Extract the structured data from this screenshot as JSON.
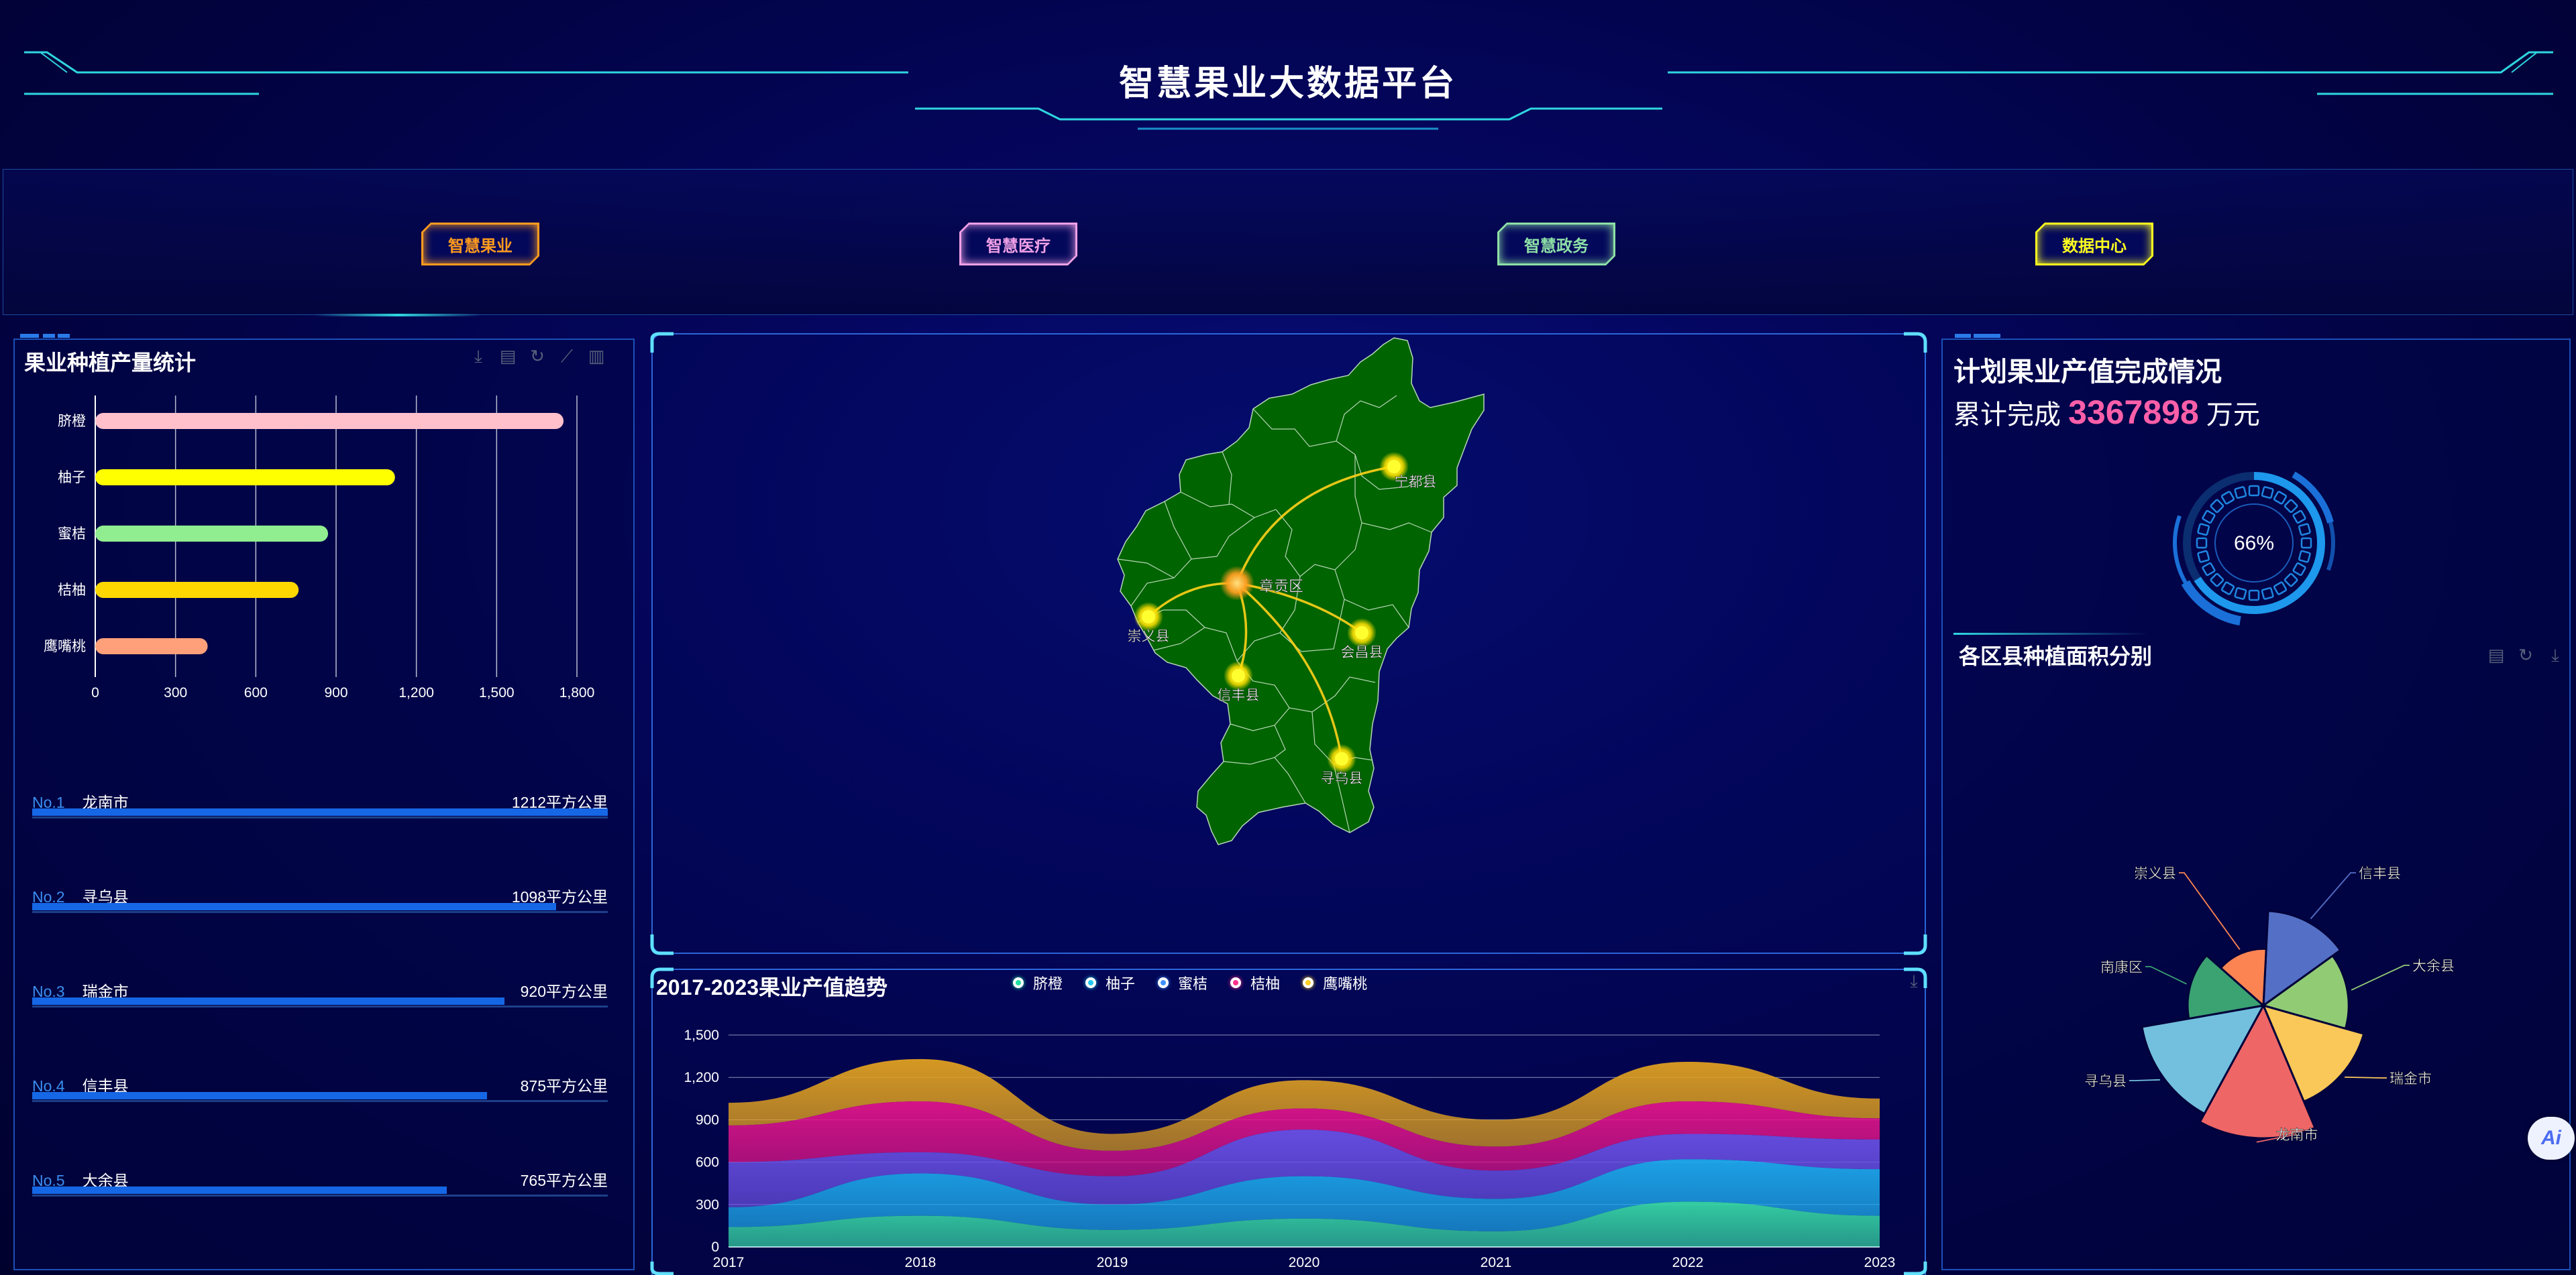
{
  "header": {
    "title": "智慧果业大数据平台"
  },
  "nav": [
    {
      "label": "智慧果业",
      "color": "#ff9b1e"
    },
    {
      "label": "智慧医疗",
      "color": "#f0a0e6"
    },
    {
      "label": "智慧政务",
      "color": "#8de0a6"
    },
    {
      "label": "数据中心",
      "color": "#ffff20"
    }
  ],
  "left": {
    "bar_title": "果业种植产量统计",
    "tools": [
      "download-icon",
      "data-view-icon",
      "refresh-icon",
      "line-chart-icon",
      "bar-chart-icon"
    ],
    "ranking": [
      {
        "no": "No.1",
        "name": "龙南市",
        "value": "1212平方公里",
        "fraction": 1.0
      },
      {
        "no": "No.2",
        "name": "寻乌县",
        "value": "1098平方公里",
        "fraction": 0.91
      },
      {
        "no": "No.3",
        "name": "瑞金市",
        "value": "920平方公里",
        "fraction": 0.82
      },
      {
        "no": "No.4",
        "name": "信丰县",
        "value": "875平方公里",
        "fraction": 0.79
      },
      {
        "no": "No.5",
        "name": "大余县",
        "value": "765平方公里",
        "fraction": 0.72
      }
    ]
  },
  "map": {
    "center": "章贡区",
    "cities": [
      "宁都县",
      "崇义县",
      "会昌县",
      "信丰县",
      "寻乌县"
    ],
    "fill": "#006400"
  },
  "trend": {
    "title": "2017-2023果业产值趋势",
    "tool": "download-icon"
  },
  "right": {
    "title": "计划果业产值完成情况",
    "total_prefix": "累计完成",
    "total_value": "3367898",
    "total_unit": "万元",
    "progress_label": "66%",
    "progress": 0.66,
    "area_title": "各区县种植面积分别",
    "tools": [
      "data-view-icon",
      "refresh-icon",
      "download-icon"
    ]
  },
  "ai_badge": "Ai",
  "chart_data": [
    {
      "type": "bar",
      "orientation": "horizontal",
      "categories": [
        "脐橙",
        "柚子",
        "蜜桔",
        "桔柚",
        "鹰嘴桃"
      ],
      "values": [
        1750,
        1120,
        870,
        760,
        420
      ],
      "colors": [
        "#ffc0cb",
        "#ffff00",
        "#90ee90",
        "#ffd700",
        "#ffa07a"
      ],
      "xticks": [
        "0",
        "300",
        "600",
        "900",
        "1,200",
        "1,500",
        "1,800"
      ],
      "xlim": [
        0,
        1800
      ],
      "grid": true
    },
    {
      "type": "area",
      "stacked": true,
      "title": "2017-2023果业产值趋势",
      "x": [
        "2017",
        "2018",
        "2019",
        "2020",
        "2021",
        "2022",
        "2023"
      ],
      "yticks": [
        "0",
        "300",
        "600",
        "900",
        "1,200",
        "1,500"
      ],
      "ylim": [
        0,
        1500
      ],
      "legend_position": "top",
      "series": [
        {
          "name": "脐橙",
          "color": "#36d6a6",
          "values": [
            140,
            220,
            120,
            200,
            110,
            320,
            220
          ]
        },
        {
          "name": "柚子",
          "color": "#1ea9ee",
          "values": [
            140,
            300,
            180,
            300,
            230,
            300,
            330
          ]
        },
        {
          "name": "蜜桔",
          "color": "#6a50e6",
          "values": [
            320,
            150,
            200,
            330,
            200,
            180,
            210
          ]
        },
        {
          "name": "桔柚",
          "color": "#e0148a",
          "values": [
            260,
            360,
            180,
            150,
            170,
            230,
            150
          ]
        },
        {
          "name": "鹰嘴桃",
          "color": "#e0a020",
          "values": [
            160,
            300,
            120,
            200,
            190,
            280,
            140
          ]
        }
      ]
    },
    {
      "type": "pie",
      "rose": true,
      "labels": [
        "信丰县",
        "大余县",
        "瑞金市",
        "龙南市",
        "寻乌县",
        "南康区",
        "崇义县"
      ],
      "values": [
        8,
        7,
        9,
        12,
        11,
        6,
        4
      ],
      "colors": [
        "#5470c6",
        "#91cc75",
        "#fac858",
        "#ee6666",
        "#73c0de",
        "#3ba272",
        "#fc8452"
      ]
    }
  ]
}
